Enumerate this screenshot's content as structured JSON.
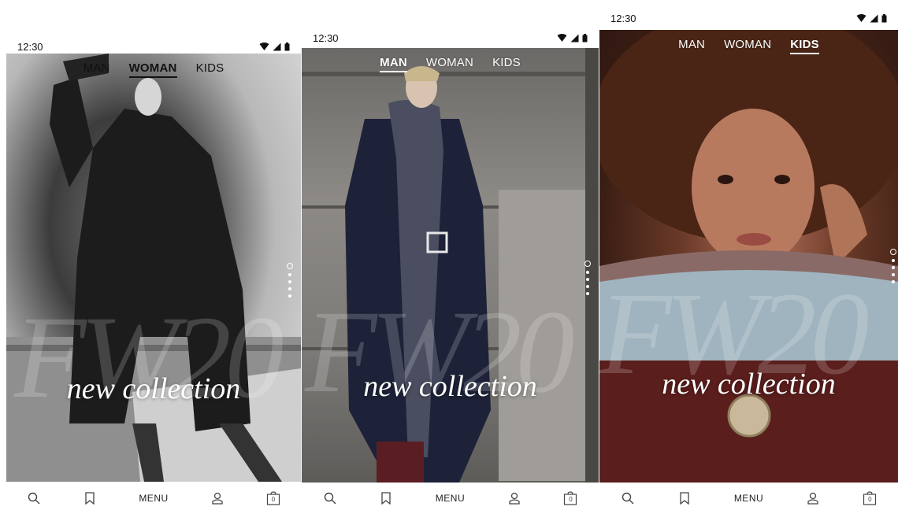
{
  "screens": [
    {
      "status": {
        "time": "12:30"
      },
      "nav": {
        "tabs": [
          "MAN",
          "WOMAN",
          "KIDS"
        ],
        "active": 1
      },
      "hero": {
        "big_text": "FW20",
        "title": "new collection"
      },
      "bottom": {
        "menu_label": "MENU",
        "bag_count": "0"
      }
    },
    {
      "status": {
        "time": "12:30"
      },
      "nav": {
        "tabs": [
          "MAN",
          "WOMAN",
          "KIDS"
        ],
        "active": 0
      },
      "hero": {
        "big_text": "FW20",
        "title": "new collection"
      },
      "bottom": {
        "menu_label": "MENU",
        "bag_count": "0"
      }
    },
    {
      "status": {
        "time": "12:30"
      },
      "nav": {
        "tabs": [
          "MAN",
          "WOMAN",
          "KIDS"
        ],
        "active": 2
      },
      "hero": {
        "big_text": "FW20",
        "title": "new collection"
      },
      "bottom": {
        "menu_label": "MENU",
        "bag_count": "0"
      }
    }
  ],
  "colors": {
    "text_dark": "#111111",
    "text_light": "#ffffff",
    "icon_gray": "#444444"
  },
  "icons": [
    "wifi-icon",
    "signal-icon",
    "battery-icon",
    "search-icon",
    "bookmark-icon",
    "user-icon",
    "bag-icon"
  ]
}
